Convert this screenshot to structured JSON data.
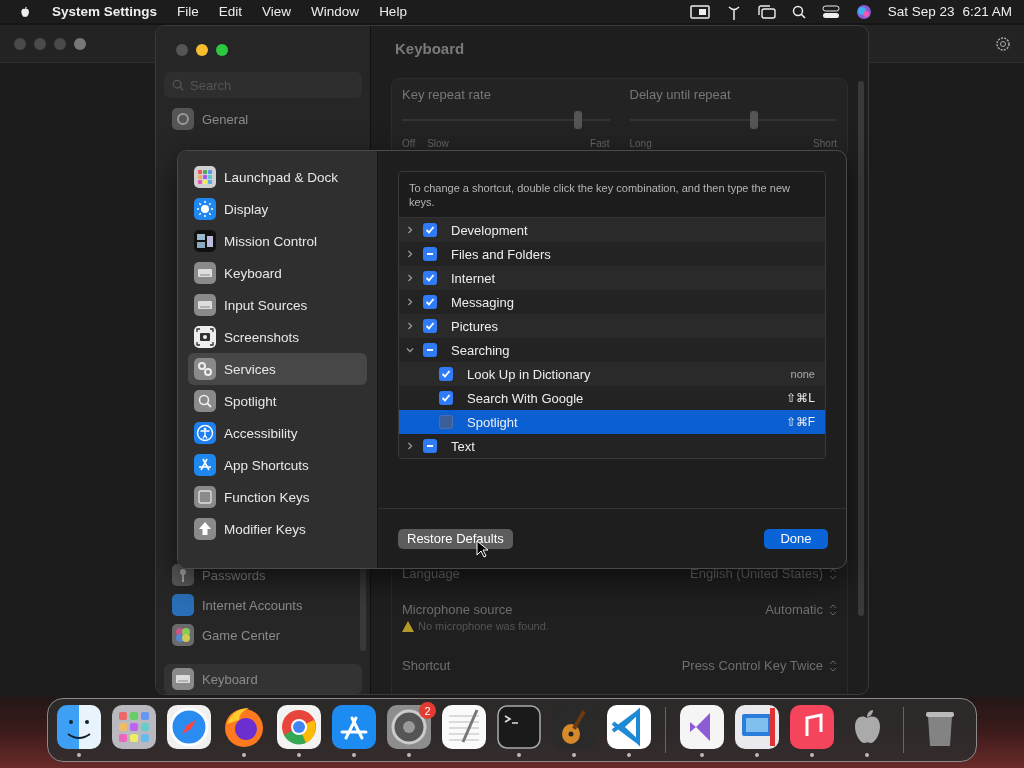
{
  "menubar": {
    "app_name": "System Settings",
    "menus": [
      "File",
      "Edit",
      "View",
      "Window",
      "Help"
    ],
    "date": "Sat Sep 23",
    "time": "6:21 AM"
  },
  "settings_window": {
    "title": "Keyboard",
    "search": {
      "placeholder": "Search"
    },
    "sidebar_top": [
      {
        "label": "General",
        "kind": "gear",
        "selected": false
      }
    ],
    "sidebar_bottom": [
      {
        "label": "Passwords",
        "kind": "key",
        "selected": false
      },
      {
        "label": "Internet Accounts",
        "kind": "at",
        "selected": false
      },
      {
        "label": "Game Center",
        "kind": "gamecenter",
        "selected": false
      },
      {
        "label": "Keyboard",
        "kind": "keyboard",
        "selected": true
      }
    ],
    "sliders": [
      {
        "label": "Key repeat rate",
        "level": 0.85,
        "ticks": [
          "Off",
          "Slow",
          "Fast"
        ]
      },
      {
        "label": "Delay until repeat",
        "level": 0.6,
        "ticks": [
          "Long",
          "Short"
        ]
      }
    ],
    "rows": [
      {
        "label": "Language",
        "value": "English (United States)"
      },
      {
        "label": "Microphone source",
        "value": "Automatic",
        "warning": "No microphone was found."
      },
      {
        "label": "Shortcut",
        "value": "Press Control Key Twice"
      }
    ]
  },
  "sheet": {
    "sidebar": [
      {
        "label": "Launchpad & Dock",
        "kind": "launchpad",
        "selected": false
      },
      {
        "label": "Display",
        "kind": "display",
        "selected": false
      },
      {
        "label": "Mission Control",
        "kind": "mission",
        "selected": false
      },
      {
        "label": "Keyboard",
        "kind": "keyboard",
        "selected": false
      },
      {
        "label": "Input Sources",
        "kind": "keyboard",
        "selected": false
      },
      {
        "label": "Screenshots",
        "kind": "screenshot",
        "selected": false
      },
      {
        "label": "Services",
        "kind": "services",
        "selected": true
      },
      {
        "label": "Spotlight",
        "kind": "spotlight",
        "selected": false
      },
      {
        "label": "Accessibility",
        "kind": "accessibility",
        "selected": false
      },
      {
        "label": "App Shortcuts",
        "kind": "appstore",
        "selected": false
      },
      {
        "label": "Function Keys",
        "kind": "fnkey",
        "selected": false
      },
      {
        "label": "Modifier Keys",
        "kind": "modifier",
        "selected": false
      }
    ],
    "hint": "To change a shortcut, double click the key combination, and then type the new keys.",
    "tree": [
      {
        "label": "Development",
        "checked": true,
        "expanded": false,
        "selected": false
      },
      {
        "label": "Files and Folders",
        "checked": true,
        "mixed": true,
        "expanded": false,
        "selected": false
      },
      {
        "label": "Internet",
        "checked": true,
        "expanded": false,
        "selected": false
      },
      {
        "label": "Messaging",
        "checked": true,
        "expanded": false,
        "selected": false
      },
      {
        "label": "Pictures",
        "checked": true,
        "expanded": false,
        "selected": false
      },
      {
        "label": "Searching",
        "checked": true,
        "mixed": true,
        "expanded": true,
        "selected": false,
        "children": [
          {
            "label": "Look Up in Dictionary",
            "checked": true,
            "shortcut": "none",
            "selected": false
          },
          {
            "label": "Search With Google",
            "checked": true,
            "shortcut": "⇧⌘L",
            "selected": false
          },
          {
            "label": "Spotlight",
            "checked": false,
            "shortcut": "⇧⌘F",
            "selected": true
          }
        ]
      },
      {
        "label": "Text",
        "checked": true,
        "mixed": true,
        "expanded": false,
        "selected": false
      }
    ],
    "buttons": [
      {
        "label": "Restore Defaults",
        "kind": "secondary"
      },
      {
        "label": "Done",
        "kind": "primary"
      }
    ]
  },
  "dock": {
    "items": [
      {
        "kind": "finder",
        "running": true
      },
      {
        "kind": "launchpad",
        "running": false
      },
      {
        "kind": "safari",
        "running": false
      },
      {
        "kind": "firefox",
        "running": true
      },
      {
        "kind": "chrome",
        "running": true
      },
      {
        "kind": "appstore",
        "running": true
      },
      {
        "kind": "settings",
        "running": true,
        "badge": "2"
      },
      {
        "kind": "textedit",
        "running": false
      },
      {
        "kind": "terminal",
        "running": true
      },
      {
        "kind": "garageband",
        "running": true
      },
      {
        "kind": "vscode",
        "running": true
      },
      {
        "kind": "separator"
      },
      {
        "kind": "visualstudio",
        "running": true
      },
      {
        "kind": "remote",
        "running": true
      },
      {
        "kind": "music",
        "running": true
      },
      {
        "kind": "apple",
        "running": true
      },
      {
        "kind": "separator"
      },
      {
        "kind": "trash",
        "running": false
      }
    ]
  }
}
